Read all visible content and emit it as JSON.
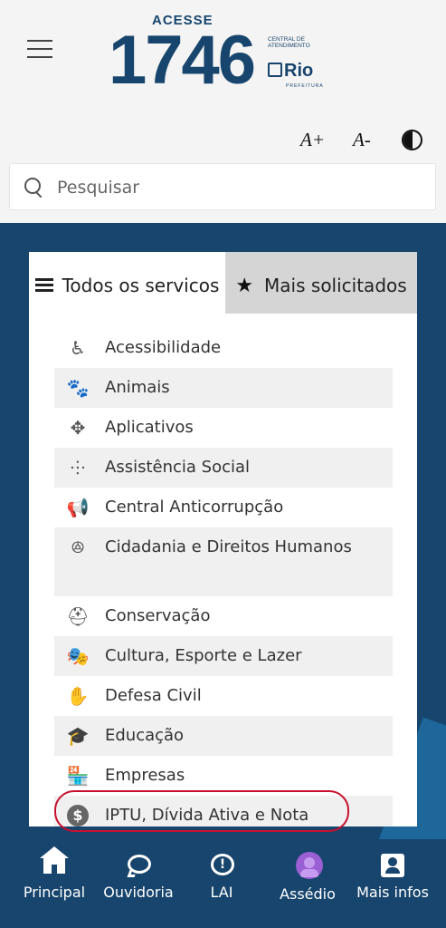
{
  "header": {
    "logo": {
      "acesse": "ACESSE",
      "number": "1746",
      "central": "CENTRAL DE ATENDIMENTO",
      "rio": "Rio",
      "prefeitura": "PREFEITURA"
    },
    "font_increase": "A+",
    "font_decrease": "A-",
    "contrast_icon": "contrast-icon"
  },
  "search": {
    "placeholder": "Pesquisar",
    "value": ""
  },
  "tabs": [
    {
      "label": "Todos os servicos",
      "icon": "list-icon",
      "active": true
    },
    {
      "label": "Mais solicitados",
      "icon": "star-icon",
      "active": false
    }
  ],
  "categories": [
    {
      "label": "Acessibilidade",
      "icon": "wheelchair-icon",
      "glyph": "♿"
    },
    {
      "label": "Animais",
      "icon": "paw-icon",
      "glyph": "🐾"
    },
    {
      "label": "Aplicativos",
      "icon": "arrows-icon",
      "glyph": "✥"
    },
    {
      "label": "Assistência Social",
      "icon": "people-icon",
      "glyph": "⸭"
    },
    {
      "label": "Central Anticorrupção",
      "icon": "megaphone-icon",
      "glyph": "📢"
    },
    {
      "label": "Cidadania e Direitos Humanos",
      "icon": "group-icon",
      "glyph": "ꔮ"
    },
    {
      "label": "Conservação",
      "icon": "hardhat-icon",
      "glyph": "⛑"
    },
    {
      "label": "Cultura, Esporte e Lazer",
      "icon": "theater-masks-icon",
      "glyph": "🎭"
    },
    {
      "label": "Defesa Civil",
      "icon": "hands-icon",
      "glyph": "✋"
    },
    {
      "label": "Educação",
      "icon": "graduation-cap-icon",
      "glyph": "🎓"
    },
    {
      "label": "Empresas",
      "icon": "store-icon",
      "glyph": "🏪"
    },
    {
      "label": "IPTU, Dívida Ativa e Nota",
      "icon": "dollar-coin-icon",
      "glyph": "$"
    }
  ],
  "bottom_nav": [
    {
      "label": "Principal",
      "icon": "home-icon"
    },
    {
      "label": "Ouvidoria",
      "icon": "chat-bubble-icon"
    },
    {
      "label": "LAI",
      "icon": "lai-info-icon",
      "glyph": "!"
    },
    {
      "label": "Assédio",
      "icon": "assedio-icon"
    },
    {
      "label": "Mais infos",
      "icon": "contact-card-icon"
    }
  ],
  "colors": {
    "brand_blue": "#17456d",
    "highlight_red": "#c8102e",
    "assedio_purple": "#9b5fd4"
  }
}
